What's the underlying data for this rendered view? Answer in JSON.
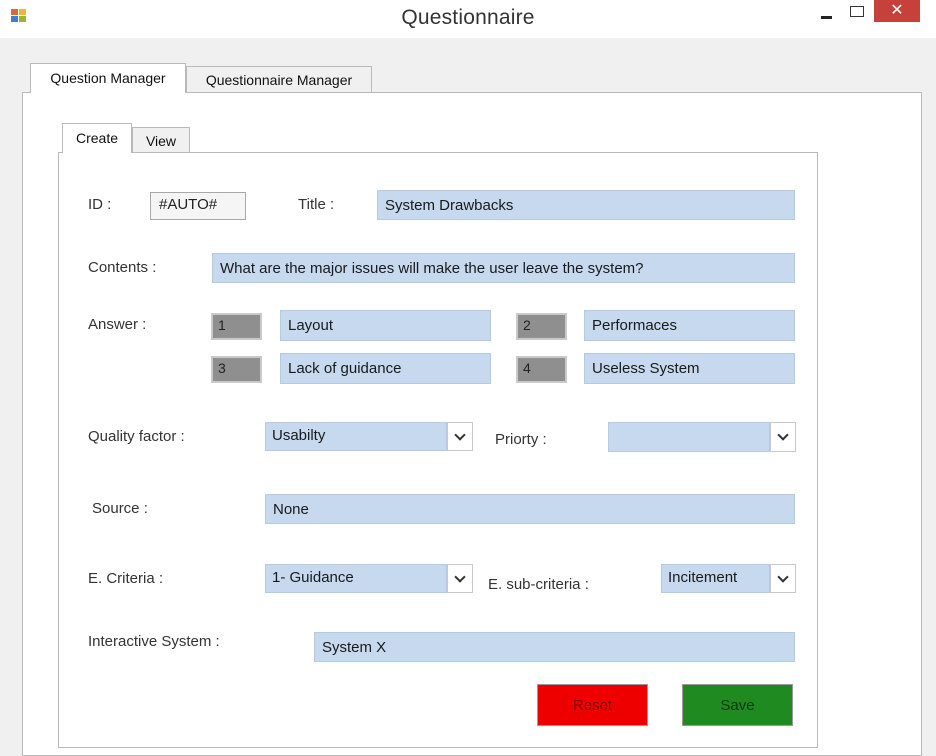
{
  "window": {
    "title": "Questionnaire",
    "close_glyph": "✕"
  },
  "tabs": {
    "question_manager": "Question Manager",
    "questionnaire_manager": "Questionnaire Manager"
  },
  "subtabs": {
    "create": "Create",
    "view": "View"
  },
  "form": {
    "id_label": "ID :",
    "id_value": "#AUTO#",
    "title_label": "Title :",
    "title_value": "System Drawbacks",
    "contents_label": "Contents :",
    "contents_value": "What are the major issues will make the user leave the system?",
    "answer_label": "Answer :",
    "answers": [
      {
        "num": "1",
        "text": "Layout"
      },
      {
        "num": "2",
        "text": "Performaces"
      },
      {
        "num": "3",
        "text": "Lack of guidance"
      },
      {
        "num": "4",
        "text": "Useless System"
      }
    ],
    "quality_label": "Quality factor :",
    "quality_value": "Usabilty",
    "priority_label": "Priorty :",
    "priority_value": "",
    "source_label": "Source :",
    "source_value": "None",
    "criteria_label": "E. Criteria :",
    "criteria_value": "1- Guidance",
    "subcriteria_label": "E. sub-criteria :",
    "subcriteria_value": "Incitement",
    "interactive_label": "Interactive System :",
    "interactive_value": "System X"
  },
  "buttons": {
    "reset": "Reset",
    "save": "Save"
  },
  "colors": {
    "field_bg": "#c6d9ef",
    "reset_bg": "#ee0000",
    "save_bg": "#1f8a1f",
    "close_bg": "#c7413b"
  }
}
